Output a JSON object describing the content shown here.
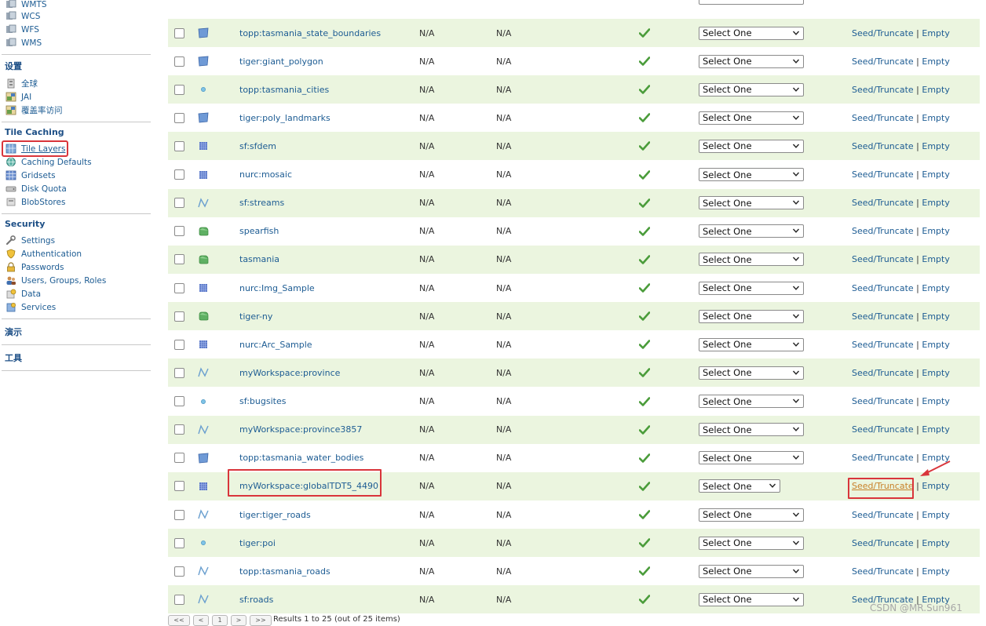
{
  "sidebar": {
    "services_items": [
      {
        "label": "WMTS",
        "icon": "service-icon"
      },
      {
        "label": "WCS",
        "icon": "service-icon"
      },
      {
        "label": "WFS",
        "icon": "service-icon"
      },
      {
        "label": "WMS",
        "icon": "service-icon"
      }
    ],
    "settings_title": "设置",
    "settings_items": [
      {
        "label": "全球",
        "icon": "global-settings-icon"
      },
      {
        "label": "JAI",
        "icon": "jai-icon"
      },
      {
        "label": "覆盖率访问",
        "icon": "coverage-access-icon"
      }
    ],
    "tile_caching_title": "Tile Caching",
    "tile_caching_items": [
      {
        "label": "Tile Layers",
        "icon": "tile-layers-icon"
      },
      {
        "label": "Caching Defaults",
        "icon": "globe-icon"
      },
      {
        "label": "Gridsets",
        "icon": "grid-icon"
      },
      {
        "label": "Disk Quota",
        "icon": "disk-icon"
      },
      {
        "label": "BlobStores",
        "icon": "blobstore-icon"
      }
    ],
    "security_title": "Security",
    "security_items": [
      {
        "label": "Settings",
        "icon": "wrench-icon"
      },
      {
        "label": "Authentication",
        "icon": "shield-icon"
      },
      {
        "label": "Passwords",
        "icon": "lock-icon"
      },
      {
        "label": "Users, Groups, Roles",
        "icon": "users-icon"
      },
      {
        "label": "Data",
        "icon": "data-icon"
      },
      {
        "label": "Services",
        "icon": "services-icon"
      }
    ],
    "demos_title": "演示",
    "tools_title": "工具"
  },
  "table": {
    "na_text": "N/A",
    "select_placeholder": "Select One",
    "seed_label": "Seed/Truncate",
    "separator": "|",
    "empty_label": "Empty",
    "rows": [
      {
        "name": "topp:tasmania_state_boundaries",
        "type": "polygon-icon"
      },
      {
        "name": "tiger:giant_polygon",
        "type": "polygon-icon"
      },
      {
        "name": "topp:tasmania_cities",
        "type": "point-icon"
      },
      {
        "name": "tiger:poly_landmarks",
        "type": "polygon-icon"
      },
      {
        "name": "sf:sfdem",
        "type": "raster-icon"
      },
      {
        "name": "nurc:mosaic",
        "type": "raster-icon"
      },
      {
        "name": "sf:streams",
        "type": "line-icon"
      },
      {
        "name": "spearfish",
        "type": "layer-group-icon"
      },
      {
        "name": "tasmania",
        "type": "layer-group-icon"
      },
      {
        "name": "nurc:Img_Sample",
        "type": "raster-icon"
      },
      {
        "name": "tiger-ny",
        "type": "layer-group-icon"
      },
      {
        "name": "nurc:Arc_Sample",
        "type": "raster-icon"
      },
      {
        "name": "myWorkspace:province",
        "type": "line-icon"
      },
      {
        "name": "sf:bugsites",
        "type": "point-icon"
      },
      {
        "name": "myWorkspace:province3857",
        "type": "line-icon"
      },
      {
        "name": "topp:tasmania_water_bodies",
        "type": "polygon-icon"
      },
      {
        "name": "myWorkspace:globalTDT5_4490",
        "type": "raster-icon"
      },
      {
        "name": "tiger:tiger_roads",
        "type": "line-icon"
      },
      {
        "name": "tiger:poi",
        "type": "point-icon"
      },
      {
        "name": "topp:tasmania_roads",
        "type": "line-icon"
      },
      {
        "name": "sf:roads",
        "type": "line-icon"
      }
    ]
  },
  "pager_info": "Results 1 to 25 (out of 25 items)",
  "watermark": "CSDN @MR.Sun961",
  "colors": {
    "accent": "#1d5c93",
    "alt_row": "#ebf5df",
    "highlight_red": "#d9353b",
    "check_green": "#4a9c3a"
  }
}
